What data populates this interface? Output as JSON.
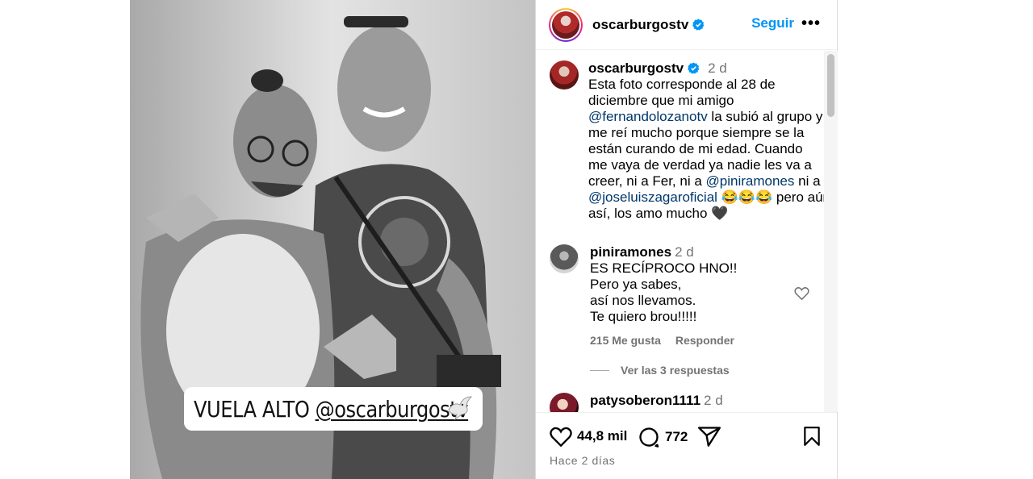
{
  "post": {
    "username": "oscarburgostv",
    "follow_label": "Seguir",
    "more_label": "•••",
    "image_caption_prefix": "VUELA ALTO",
    "image_caption_handle": "@oscarburgostv"
  },
  "caption": {
    "username": "oscarburgostv",
    "time": "2 d",
    "lines": [
      {
        "text": "Esta foto corresponde al 28 de"
      },
      {
        "text": "diciembre que mi amigo"
      },
      {
        "mention": "@fernandolozanotv",
        "text": " la subió al grupo y"
      },
      {
        "text": "me  reí  mucho porque siempre se la"
      },
      {
        "text": "están curando de mi edad. Cuando"
      },
      {
        "text": "me vaya de verdad ya nadie les va a"
      },
      {
        "text": "creer, ni a Fer, ni a ",
        "mention": "@piniramones",
        "text2": " ni a"
      },
      {
        "mention": "@joseluiszagaroficial",
        "text": " 😂😂😂 pero aún"
      },
      {
        "text": "así, los amo mucho 🖤"
      }
    ]
  },
  "comments": [
    {
      "username": "piniramones",
      "time": "2 d",
      "lines": [
        "ES RECÍPROCO HNO!!",
        "Pero ya sabes,",
        "así nos llevamos.",
        "Te quiero brou!!!!!"
      ],
      "likes": "215 Me gusta",
      "reply_label": "Responder",
      "view_replies": "Ver las 3 respuestas"
    },
    {
      "username": "patysoberon1111",
      "time": "2 d"
    }
  ],
  "actions": {
    "likes_count": "44,8 mil",
    "comments_count": "772",
    "posted": "Hace 2 días"
  },
  "colors": {
    "link": "#0095f6",
    "mention": "#00376b",
    "secondary": "#737373",
    "verified": "#0095f6"
  },
  "icons": [
    "verified-badge-icon",
    "more-options-icon",
    "heart-icon",
    "comment-icon",
    "share-icon",
    "bookmark-icon",
    "dove-icon"
  ]
}
